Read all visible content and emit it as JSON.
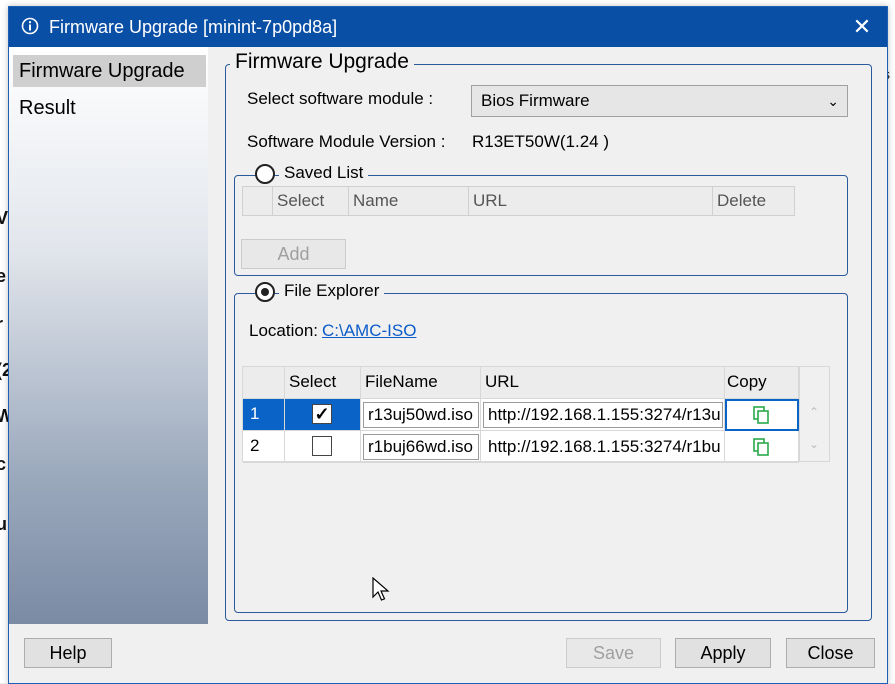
{
  "dialog": {
    "title": "Firmware Upgrade [minint-7p0pd8a]",
    "close_glyph": "✕"
  },
  "nav": {
    "items": [
      {
        "label": "Firmware Upgrade",
        "selected": true
      },
      {
        "label": "Result",
        "selected": false
      }
    ]
  },
  "main": {
    "group_title": "Firmware Upgrade",
    "module_label": "Select software module :",
    "module_value": "Bios Firmware",
    "version_label": "Software Module Version :",
    "version_value": "R13ET50W(1.24 )"
  },
  "saved_list": {
    "title": "Saved List",
    "selected": false,
    "columns": [
      "Select",
      "Name",
      "URL",
      "Delete"
    ],
    "add_label": "Add"
  },
  "file_explorer": {
    "title": "File Explorer",
    "selected": true,
    "location_label": "Location:",
    "location_value": "C:\\AMC-ISO",
    "columns": [
      "Select",
      "FileName",
      "URL",
      "Copy"
    ],
    "rows": [
      {
        "index": "1",
        "checked": true,
        "filename": "r13uj50wd.iso",
        "url": "http://192.168.1.155:3274/r13u",
        "selected": true
      },
      {
        "index": "2",
        "checked": false,
        "filename": "r1buj66wd.iso",
        "url": "http://192.168.1.155:3274/r1bu",
        "selected": false
      }
    ]
  },
  "footer": {
    "help": "Help",
    "save": "Save",
    "apply": "Apply",
    "close": "Close"
  },
  "colors": {
    "titlebar": "#0a4fa6",
    "group_border": "#2b5a9c",
    "link": "#0b5cc9",
    "selection": "#0a64c8",
    "copy_icon": "#2aa84a"
  },
  "background_fragments": {
    "right": [
      "s",
      "r"
    ],
    "left": [
      "V",
      "e",
      "r",
      "(2",
      "W",
      "c",
      "u"
    ]
  }
}
